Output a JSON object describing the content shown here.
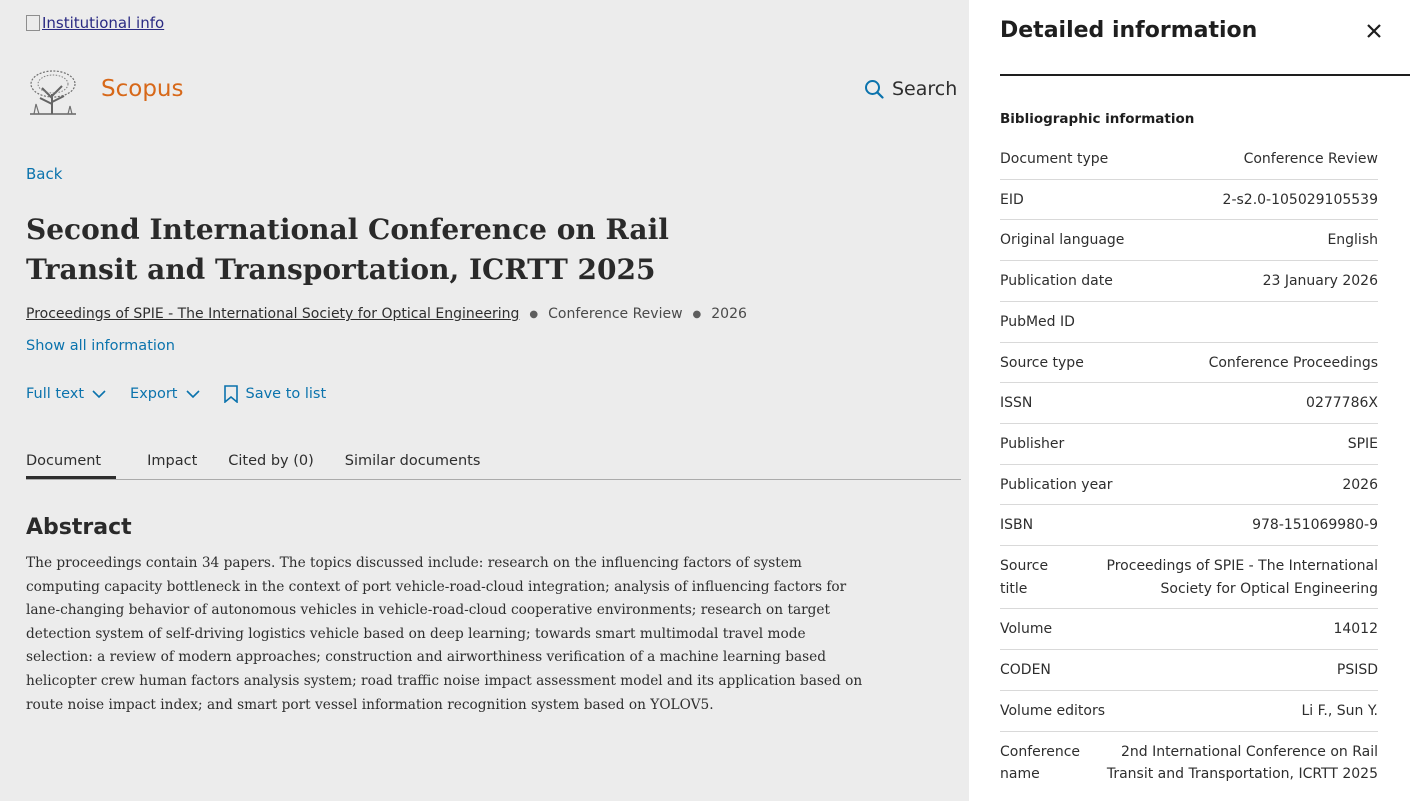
{
  "header": {
    "institutional_link": "Institutional info",
    "brand": "Scopus",
    "search_label": "Search"
  },
  "document": {
    "back_label": "Back",
    "title": "Second International Conference on Rail Transit and Transportation, ICRTT 2025",
    "source": "Proceedings of SPIE - The International Society for Optical Engineering",
    "doc_type": "Conference Review",
    "year": "2026",
    "show_all": "Show all information",
    "actions": {
      "full_text": "Full text",
      "export": "Export",
      "save": "Save to list"
    },
    "tabs": [
      {
        "label": "Document"
      },
      {
        "label": "Impact"
      },
      {
        "label": "Cited by (0)"
      },
      {
        "label": "Similar documents"
      }
    ],
    "abstract_heading": "Abstract",
    "abstract": "The proceedings contain 34 papers. The topics discussed include: research on the influencing factors of system computing capacity bottleneck in the context of port vehicle-road-cloud integration; analysis of influencing factors for lane-changing behavior of autonomous vehicles in vehicle-road-cloud cooperative environments; research on target detection system of self-driving logistics vehicle based on deep learning; towards smart multimodal travel mode selection: a review of modern approaches; construction and airworthiness verification of a machine learning based helicopter crew human factors analysis system; road traffic noise impact assessment model and its application based on route noise impact index; and smart port vessel information recognition system based on YOLOV5."
  },
  "drawer": {
    "title": "Detailed information",
    "section": "Bibliographic information",
    "rows": [
      {
        "label": "Document type",
        "value": "Conference Review"
      },
      {
        "label": "EID",
        "value": "2-s2.0-105029105539"
      },
      {
        "label": "Original language",
        "value": "English"
      },
      {
        "label": "Publication date",
        "value": "23 January 2026"
      },
      {
        "label": "PubMed ID",
        "value": ""
      },
      {
        "label": "Source type",
        "value": "Conference Proceedings"
      },
      {
        "label": "ISSN",
        "value": "0277786X"
      },
      {
        "label": "Publisher",
        "value": "SPIE"
      },
      {
        "label": "Publication year",
        "value": "2026"
      },
      {
        "label": "ISBN",
        "value": "978-151069980-9"
      },
      {
        "label": "Source title",
        "value": "Proceedings of SPIE - The International Society for Optical Engineering"
      },
      {
        "label": "Volume",
        "value": "14012"
      },
      {
        "label": "CODEN",
        "value": "PSISD"
      },
      {
        "label": "Volume editors",
        "value": "Li F., Sun Y."
      },
      {
        "label": "Conference name",
        "value": "2nd International Conference on Rail Transit and Transportation, ICRTT 2025"
      }
    ]
  },
  "colors": {
    "brand": "#e9711c",
    "link": "#0c7dbb"
  }
}
